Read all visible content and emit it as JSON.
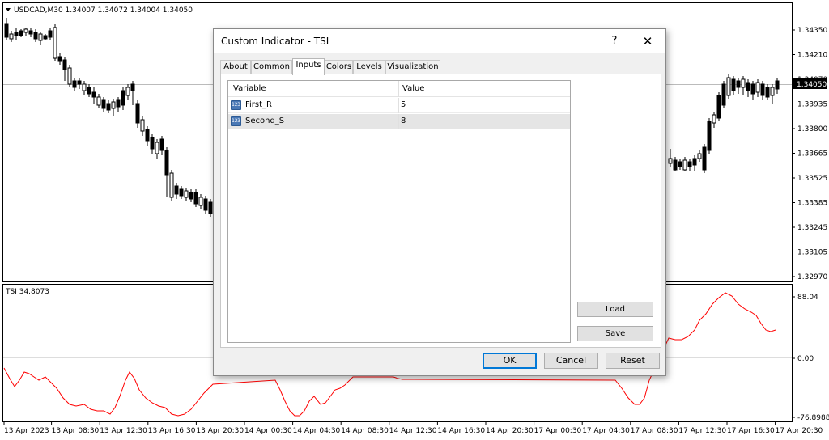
{
  "main_chart": {
    "symbol_info": "USDCAD,M30  1.34007 1.34072 1.34004 1.34050",
    "price_ticks": [
      "1.34350",
      "1.34210",
      "1.34070",
      "1.33935",
      "1.33800",
      "1.33665",
      "1.33525",
      "1.33385",
      "1.33245",
      "1.33105",
      "1.32970"
    ],
    "current_price": "1.34050",
    "colors": {
      "current_price_bg": "#000000",
      "current_price_text": "#ffffff",
      "candle": "#000000"
    }
  },
  "indicator_pane": {
    "label": "TSI 34.8073",
    "ticks": [
      "88.04",
      "0.00",
      "-76.8988"
    ],
    "line_color": "#ff0000"
  },
  "time_axis": {
    "labels": [
      "13 Apr 2023",
      "13 Apr 08:30",
      "13 Apr 12:30",
      "13 Apr 16:30",
      "13 Apr 20:30",
      "14 Apr 00:30",
      "14 Apr 04:30",
      "14 Apr 08:30",
      "14 Apr 12:30",
      "14 Apr 16:30",
      "14 Apr 20:30",
      "17 Apr 00:30",
      "17 Apr 04:30",
      "17 Apr 08:30",
      "17 Apr 12:30",
      "17 Apr 16:30",
      "17 Apr 20:30"
    ]
  },
  "dialog": {
    "title": "Custom Indicator - TSI",
    "help_glyph": "?",
    "close_glyph": "✕",
    "tabs": [
      {
        "label": "About",
        "active": false
      },
      {
        "label": "Common",
        "active": false
      },
      {
        "label": "Inputs",
        "active": true
      },
      {
        "label": "Colors",
        "active": false
      },
      {
        "label": "Levels",
        "active": false
      },
      {
        "label": "Visualization",
        "active": false
      }
    ],
    "table": {
      "headers": [
        "Variable",
        "Value"
      ],
      "rows": [
        {
          "icon": "integer-type-icon",
          "icon_text": "123",
          "variable": "First_R",
          "value": "5",
          "selected": false
        },
        {
          "icon": "integer-type-icon",
          "icon_text": "123",
          "variable": "Second_S",
          "value": "8",
          "selected": true
        }
      ]
    },
    "load_label": "Load",
    "save_label": "Save",
    "ok_label": "OK",
    "cancel_label": "Cancel",
    "reset_label": "Reset"
  }
}
